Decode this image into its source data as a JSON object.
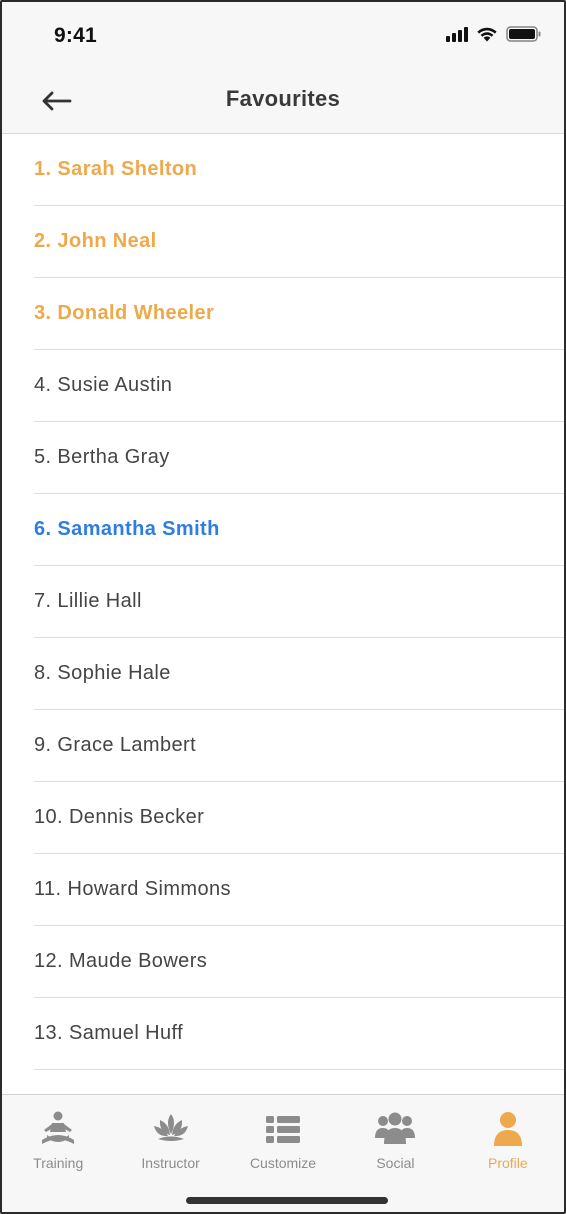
{
  "status_bar": {
    "time": "9:41"
  },
  "header": {
    "title": "Favourites",
    "back_icon": "arrow-left-icon"
  },
  "colors": {
    "highlight_gold": "#eda94b",
    "highlight_blue": "#2f7ddf",
    "text": "#454545"
  },
  "favourites": [
    {
      "label": "1. Sarah Shelton",
      "style": "gold"
    },
    {
      "label": "2. John Neal",
      "style": "gold"
    },
    {
      "label": "3. Donald Wheeler",
      "style": "gold"
    },
    {
      "label": "4. Susie Austin",
      "style": "normal"
    },
    {
      "label": "5. Bertha Gray",
      "style": "normal"
    },
    {
      "label": "6. Samantha Smith",
      "style": "blue"
    },
    {
      "label": "7. Lillie Hall",
      "style": "normal"
    },
    {
      "label": "8. Sophie Hale",
      "style": "normal"
    },
    {
      "label": "9. Grace Lambert",
      "style": "normal"
    },
    {
      "label": "10. Dennis Becker",
      "style": "normal"
    },
    {
      "label": "11. Howard Simmons",
      "style": "normal"
    },
    {
      "label": "12. Maude Bowers",
      "style": "normal"
    },
    {
      "label": "13. Samuel Huff",
      "style": "normal"
    }
  ],
  "tab_bar": {
    "tabs": [
      {
        "label": "Training",
        "icon": "meditation-icon",
        "active": false
      },
      {
        "label": "Instructor",
        "icon": "lotus-icon",
        "active": false
      },
      {
        "label": "Customize",
        "icon": "list-icon",
        "active": false
      },
      {
        "label": "Social",
        "icon": "group-icon",
        "active": false
      },
      {
        "label": "Profile",
        "icon": "user-icon",
        "active": true
      }
    ]
  }
}
